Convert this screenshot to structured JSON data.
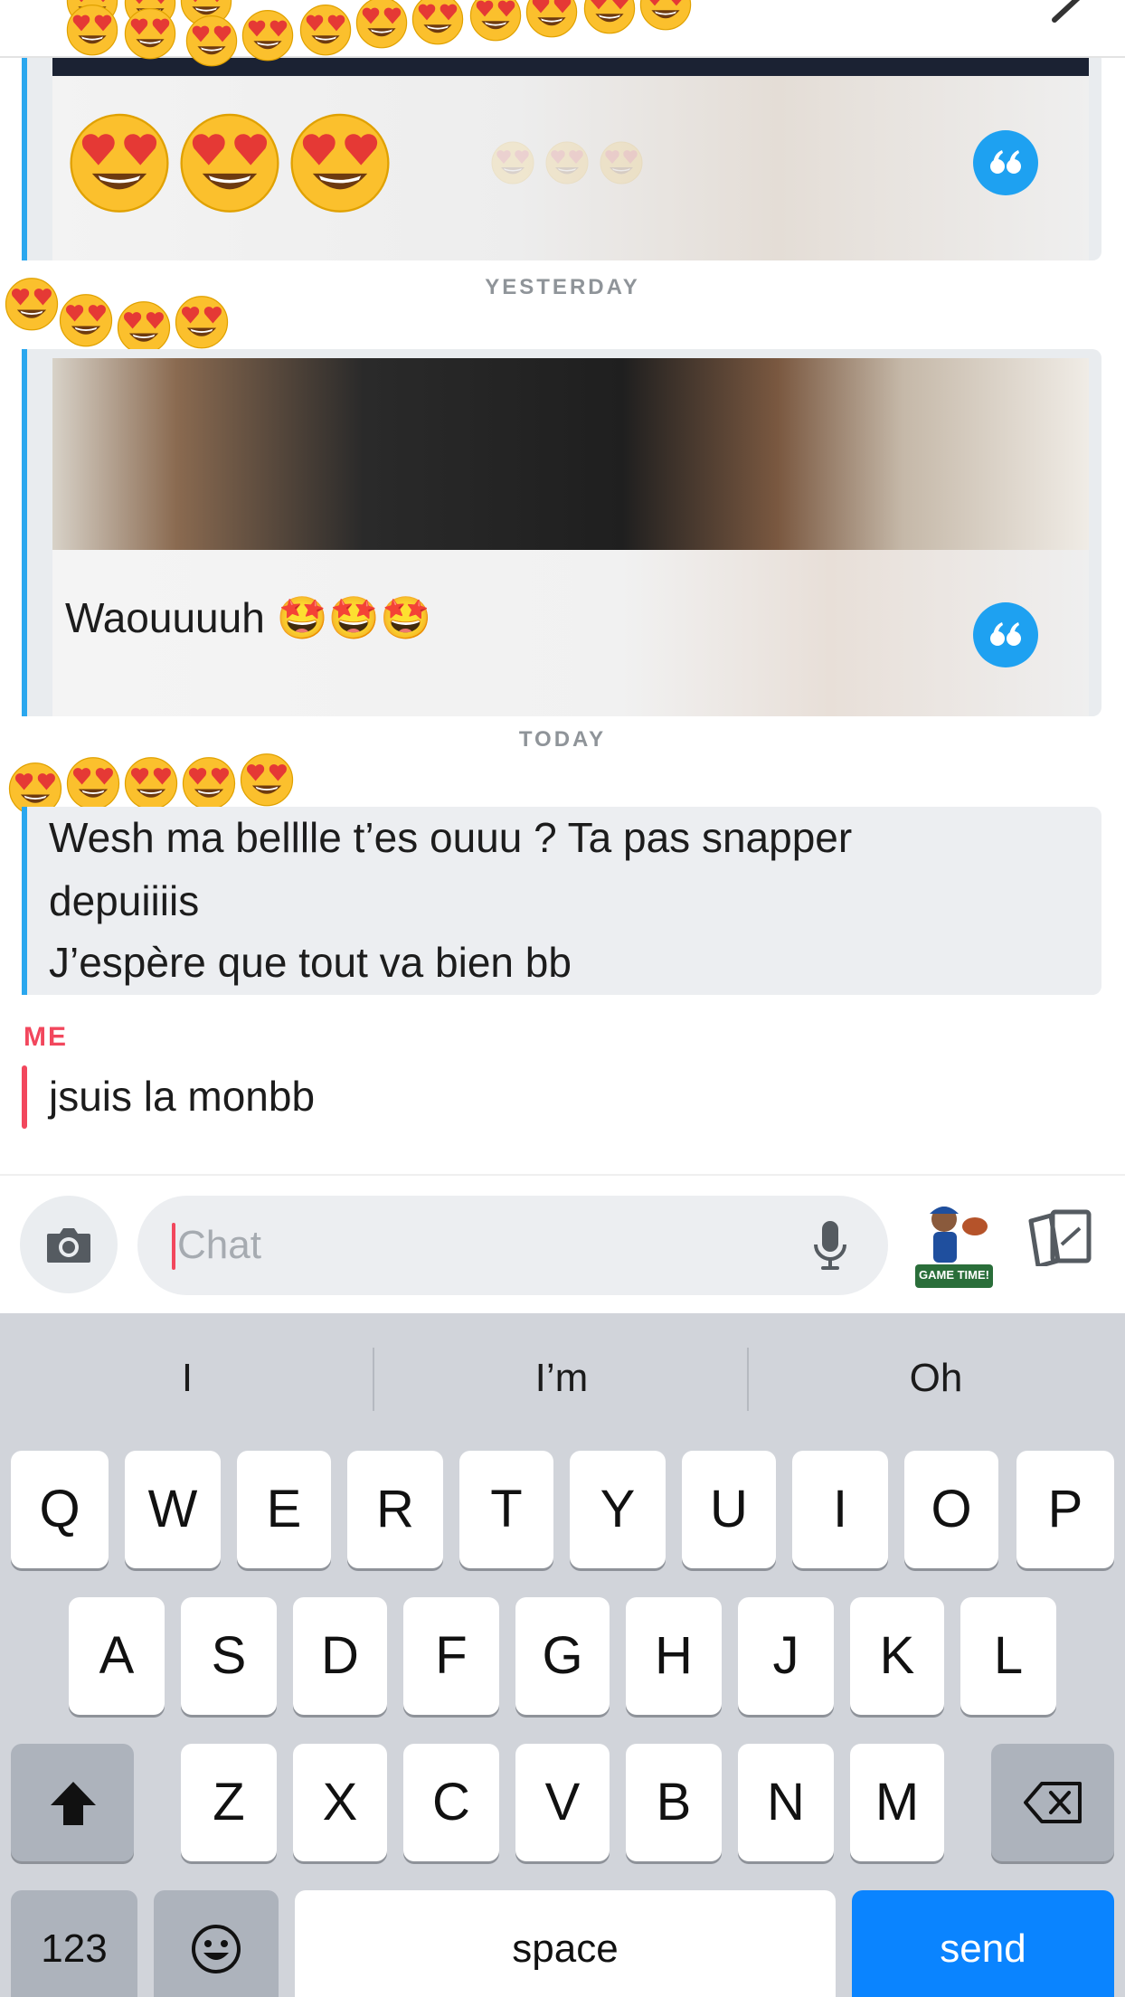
{
  "header": {
    "back_icon": "chevron-icon"
  },
  "conversation": {
    "cards": [
      {
        "caption_emojis": "😍😍😍",
        "reply_icon": "quote-reply-icon"
      },
      {
        "caption": "Waouuuuh 🤩🤩🤩",
        "reply_icon": "quote-reply-icon"
      }
    ],
    "day_labels": {
      "yesterday": "YESTERDAY",
      "today": "TODAY"
    },
    "text_message": {
      "lines": [
        "Wesh ma belllle t’es ouuu ? Ta pas snapper",
        "depuiiiis",
        "J’espère que tout va bien bb"
      ]
    },
    "me": {
      "label": "ME",
      "text": "jsuis la monbb"
    }
  },
  "compose": {
    "placeholder": "Chat",
    "camera_icon": "camera-icon",
    "mic_icon": "microphone-icon",
    "bitmoji_caption": "GAME TIME!",
    "cards_icon": "cards-icon"
  },
  "keyboard": {
    "suggestions": [
      "I",
      "I’m",
      "Oh"
    ],
    "row1": [
      "Q",
      "W",
      "E",
      "R",
      "T",
      "Y",
      "U",
      "I",
      "O",
      "P"
    ],
    "row2": [
      "A",
      "S",
      "D",
      "F",
      "G",
      "H",
      "J",
      "K",
      "L"
    ],
    "row3": [
      "Z",
      "X",
      "C",
      "V",
      "B",
      "N",
      "M"
    ],
    "numbers_key": "123",
    "space_key": "space",
    "send_key": "send"
  },
  "colors": {
    "accent_blue": "#2aa7ee",
    "me_red": "#f2475d",
    "send_blue": "#0a84ff"
  }
}
